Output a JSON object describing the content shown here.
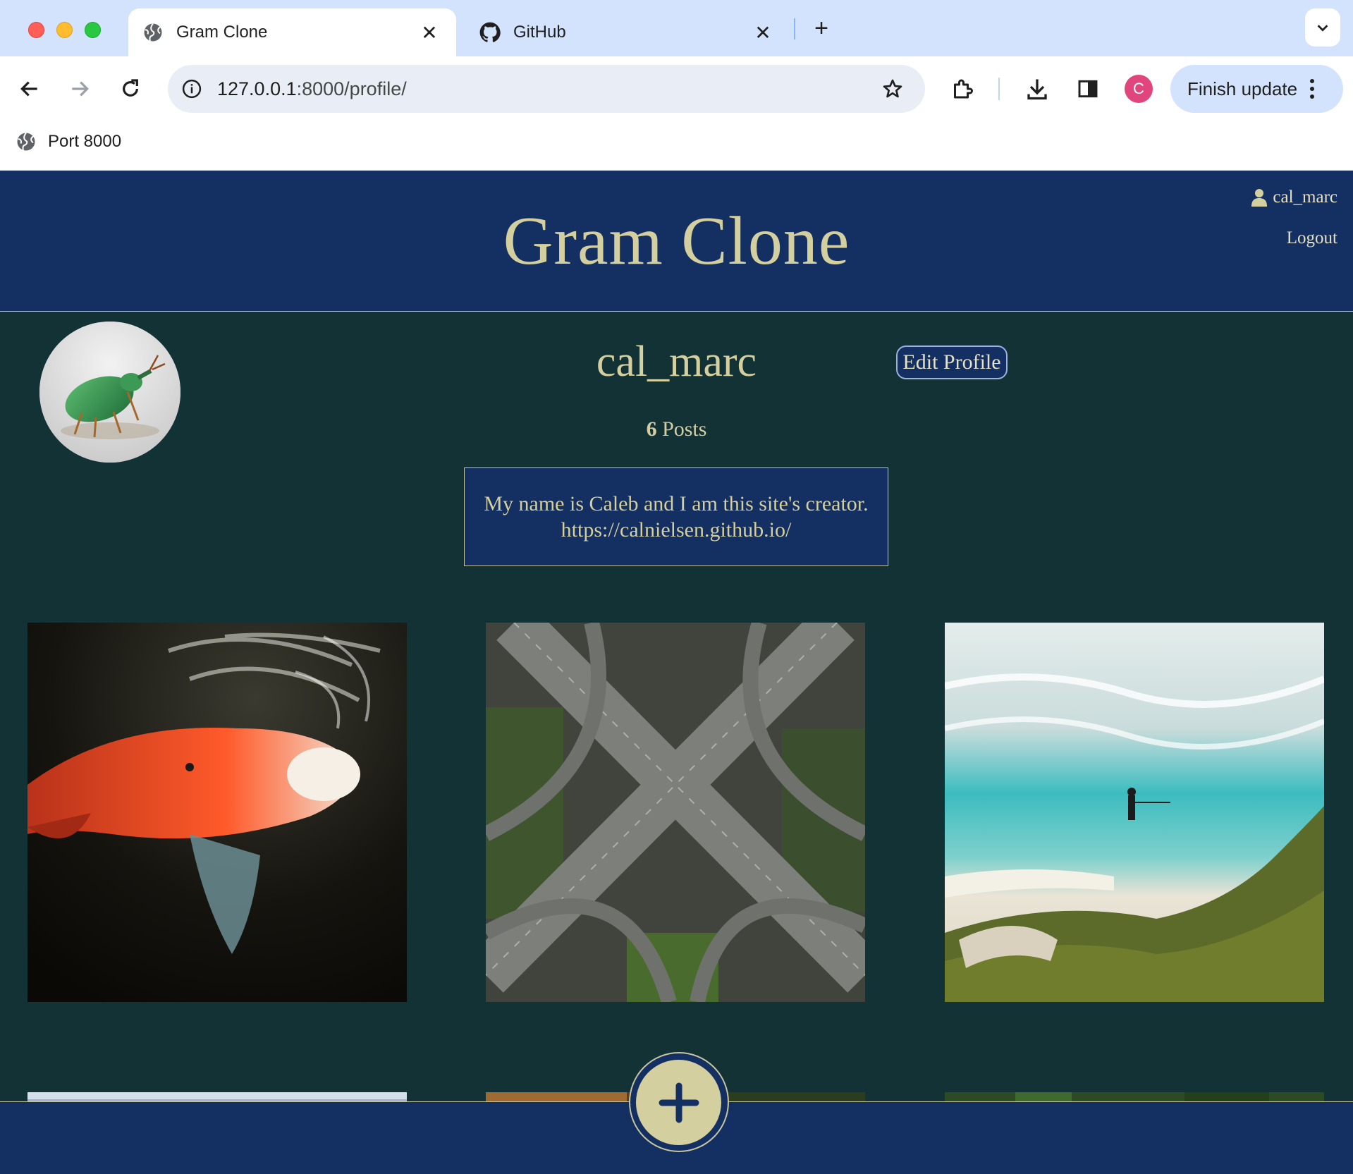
{
  "browser": {
    "tabs": [
      {
        "title": "Gram Clone",
        "active": true
      },
      {
        "title": "GitHub",
        "active": false
      }
    ],
    "url_host": "127.0.0.1",
    "url_path": ":8000/profile/",
    "profile_initial": "C",
    "update_label": "Finish update",
    "bookmarks": [
      {
        "label": "Port 8000"
      }
    ],
    "colors": {
      "tabstrip": "#d3e3fd",
      "omnibox": "#e9eef6",
      "profile": "#e0467c"
    }
  },
  "site": {
    "brand": "Gram Clone",
    "user_link": "cal_marc",
    "logout": "Logout",
    "colors": {
      "header": "#142f61",
      "body": "#133236",
      "accent": "#d4cf9f"
    }
  },
  "profile": {
    "username": "cal_marc",
    "edit_label": "Edit Profile",
    "post_count": "6",
    "posts_label": " Posts",
    "bio_line1": "My name is Caleb and I am this site's creator.",
    "bio_line2": "https://calnielsen.github.io/"
  },
  "posts": [
    {
      "subject": "koi fish"
    },
    {
      "subject": "highway interchange"
    },
    {
      "subject": "beach with fisherman"
    },
    {
      "subject": "sky"
    },
    {
      "subject": "foliage"
    },
    {
      "subject": "greenery"
    }
  ]
}
